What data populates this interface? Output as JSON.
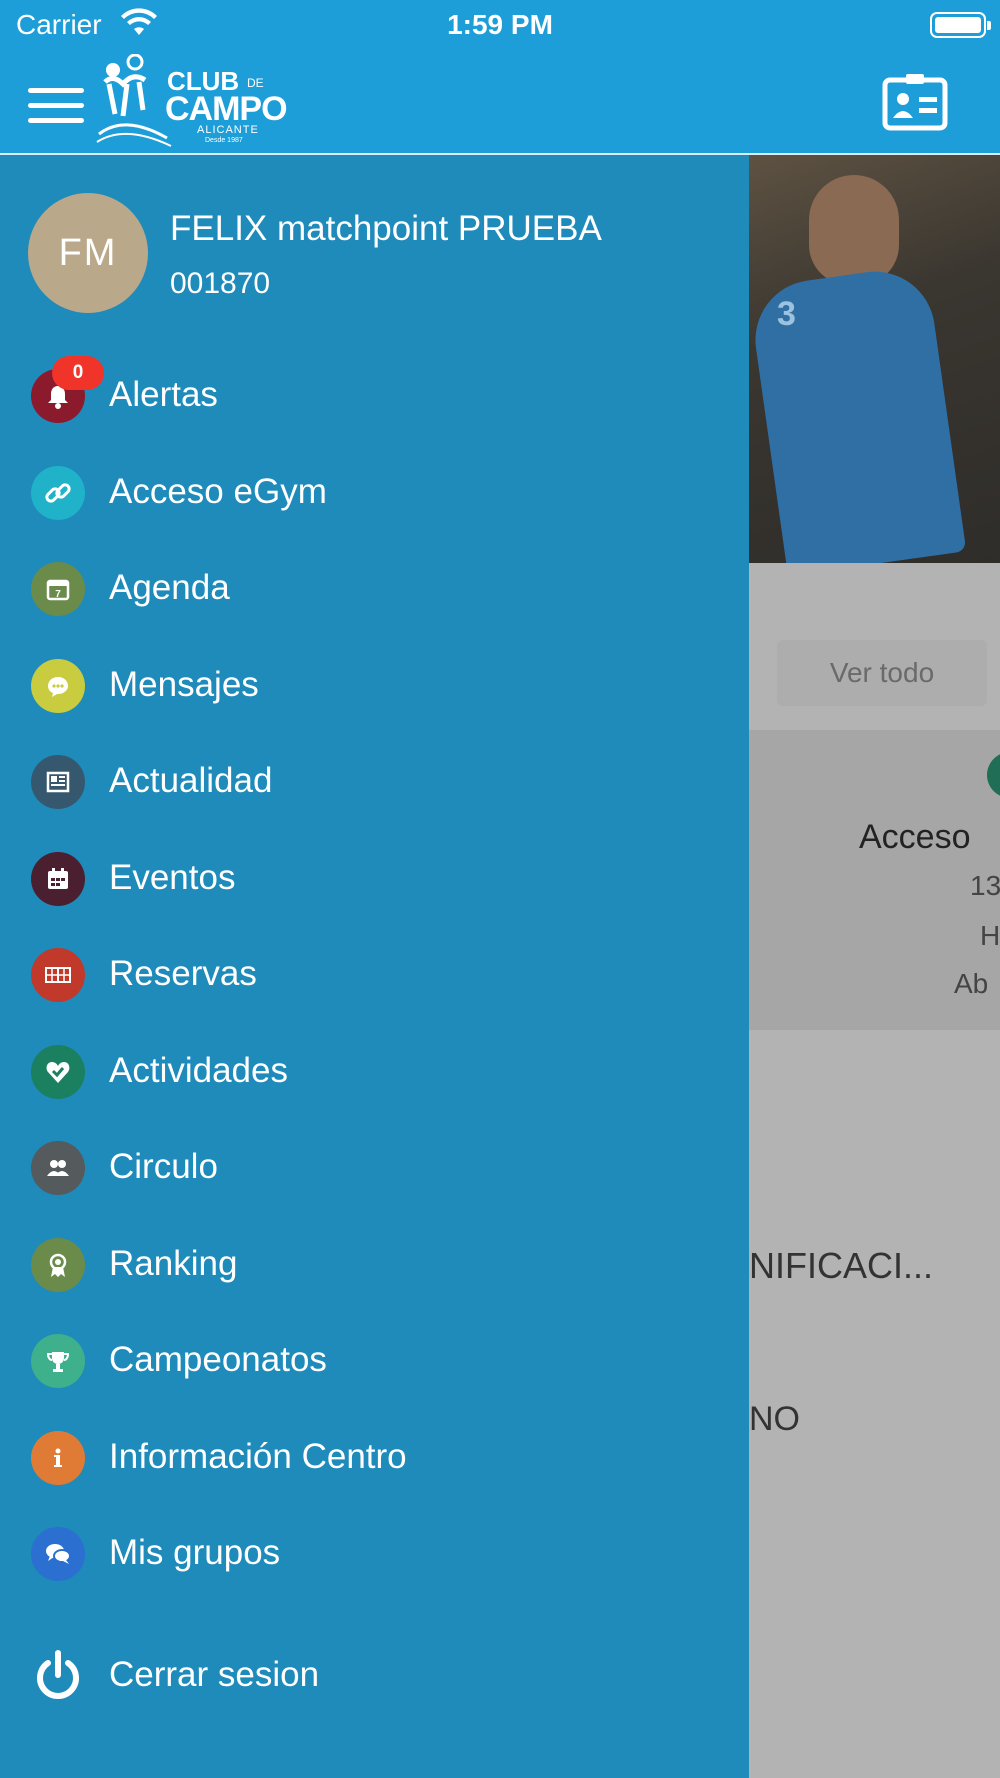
{
  "status_bar": {
    "carrier": "Carrier",
    "time": "1:59 PM"
  },
  "header": {
    "logo": {
      "line1": "CLUB",
      "line1_suffix": "DE",
      "line2": "CAMPO",
      "line3": "ALICANTE",
      "line4": "Desde 1987"
    }
  },
  "user": {
    "initials": "FM",
    "name": "FELIX matchpoint PRUEBA",
    "id": "001870"
  },
  "alerts_badge": "0",
  "menu": [
    {
      "label": "Alertas",
      "icon": "bell-icon",
      "color": "#8b1a2c"
    },
    {
      "label": "Acceso eGym",
      "icon": "link-icon",
      "color": "#1fb2c9"
    },
    {
      "label": "Agenda",
      "icon": "calendar-icon",
      "color": "#6b8b4a"
    },
    {
      "label": "Mensajes",
      "icon": "chat-icon",
      "color": "#c8cc3e"
    },
    {
      "label": "Actualidad",
      "icon": "newspaper-icon",
      "color": "#36586e"
    },
    {
      "label": "Eventos",
      "icon": "event-calendar-icon",
      "color": "#4a2030"
    },
    {
      "label": "Reservas",
      "icon": "court-icon",
      "color": "#c0392b"
    },
    {
      "label": "Actividades",
      "icon": "heart-check-icon",
      "color": "#1a8060"
    },
    {
      "label": "Circulo",
      "icon": "people-icon",
      "color": "#555a5c"
    },
    {
      "label": "Ranking",
      "icon": "medal-icon",
      "color": "#6b8b4a"
    },
    {
      "label": "Campeonatos",
      "icon": "trophy-icon",
      "color": "#3fb08c"
    },
    {
      "label": "Información Centro",
      "icon": "info-icon",
      "color": "#e07b36"
    },
    {
      "label": "Mis grupos",
      "icon": "group-chat-icon",
      "color": "#2b6fd0"
    }
  ],
  "logout": {
    "label": "Cerrar sesion",
    "icon": "power-icon"
  },
  "background_content": {
    "hero_number": "3",
    "see_all": "Ver todo",
    "card_title": "Acceso",
    "card_line1": "13",
    "card_line2": "H",
    "card_line3": "Ab",
    "partial_text1": "NIFICACI...",
    "partial_text2": "NO"
  }
}
